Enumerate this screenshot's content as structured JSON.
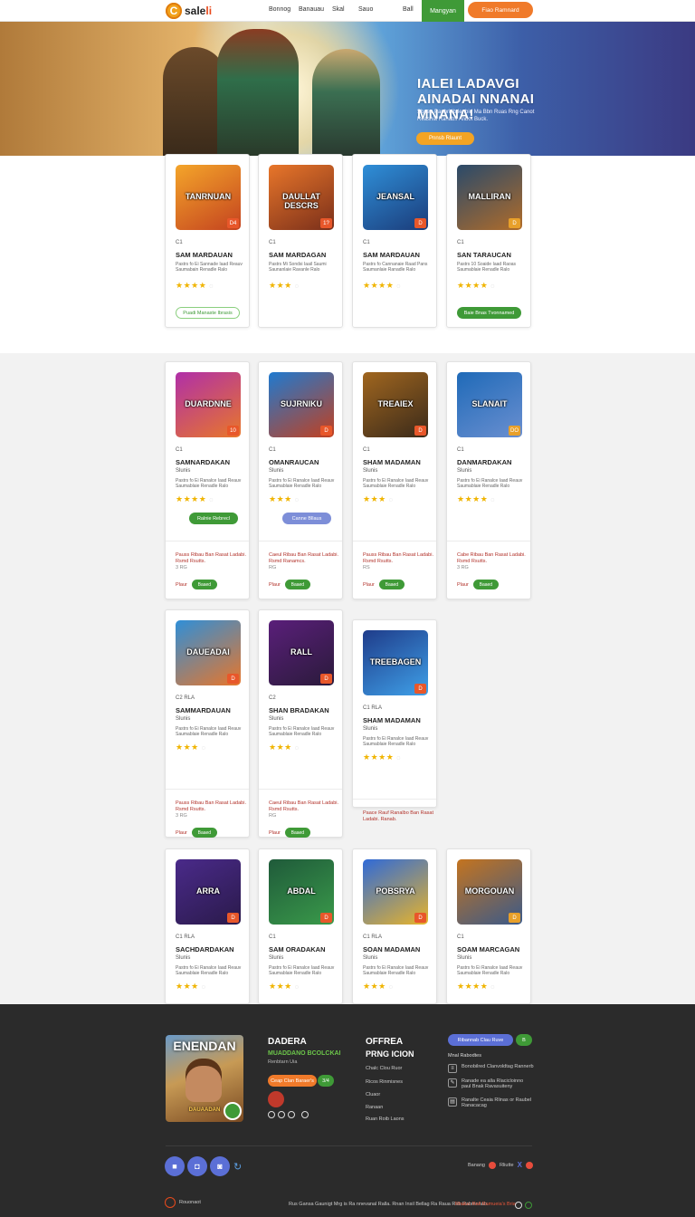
{
  "nav": {
    "logo_mark": "C",
    "logo_text": "sale",
    "logo_accent": "li",
    "links": [
      "Bonnog",
      "Banauau",
      "Skal",
      "Sauo",
      "Ball"
    ],
    "active": "Mangyan",
    "cta": "Fiao Ramnard"
  },
  "hero": {
    "title": "IALEI LADAVGI AINADAI NNANAI MNANA!",
    "subtitle": "Sbaeo Panbri Ib Ienbid Ma Bbn Ruas Rng Canot Reasnia Ranabs Anbot Buck.",
    "button": "Pnnsb Rlaunt"
  },
  "colors": {
    "accent_green": "#3f9a37",
    "accent_orange": "#f07a2a",
    "accent_blue": "#5b6fd6",
    "star": "#f0b400",
    "footer_bg": "#2b2b2b"
  },
  "section1": [
    {
      "thumb": "TANRNUAN",
      "badge": "D4",
      "meta": "C1",
      "name": "SAM MARDAUAN",
      "desc": "Pastrs fo Ei Sannade Iaad Reauv Saumabain Renadle Ralo",
      "rating": 3.5,
      "button": "Puadi Manaste Ibrasis"
    },
    {
      "thumb": "DAULLAT DESCRS",
      "badge": "1?",
      "meta": "C1",
      "name": "SAM MARDAGAN",
      "desc": "Pastrs Mi Sondsi Iaail Saumi Saunanlaie Ravanle Ralo",
      "rating": 3,
      "button": null
    },
    {
      "thumb": "JEANSAL",
      "badge": "D",
      "meta": "C1",
      "name": "SAM MARDAUAN",
      "desc": "Pastrs fo Cannanaie Raad Pans Saumanlaie Ranadle Ralo",
      "rating": 3.5,
      "button": null
    },
    {
      "thumb": "MALLIRAN",
      "badge": "D",
      "meta": "C1",
      "name": "SAN TARAUCAN",
      "desc": "Pastrs 10 Soaide Iaad Raoas Saumablaie Renadle Ralo",
      "rating": 3.5,
      "button": "Baie Bnas Tvonnamed"
    }
  ],
  "section2": [
    {
      "thumb": "DUARDNNE",
      "badge": "10",
      "meta": "C1",
      "name": "SAMNARDAKAN",
      "sub": "Slunis",
      "desc": "Pastrs fo Ei Ranalce Iaad Reauv Saumablaie Renadle Ralo",
      "rating": 3.5,
      "button": "Ralnie Rebrecl",
      "btn_style": "green",
      "deal": "Pauss Ribau Ban Rasat Ladabi. Rsmd Rsutts.",
      "deal_sub": "3 RG",
      "foot_label": "Plaur",
      "foot_btn": "Baaed"
    },
    {
      "thumb": "SUJRNIKU",
      "badge": "D",
      "meta": "C1",
      "name": "OMANRAUCAN",
      "sub": "Slunis",
      "desc": "Pastrs fo Ei Ranalce Iaad Reauv Saumablaie Renadle Ralo",
      "rating": 3,
      "button": "Canne Bllaus",
      "btn_style": "blue",
      "deal": "Caeul Ribau Ban Rasat Ladabi. Rsmd Ranamcs.",
      "deal_sub": "RG",
      "foot_label": "Plaur",
      "foot_btn": "Baaed"
    },
    {
      "thumb": "TREAIEX",
      "badge": "D",
      "meta": "C1",
      "name": "SHAM MADAMAN",
      "sub": "Slunis",
      "desc": "Pastrs fo Ei Ranalce Iaad Reauv Saumablaie Renadle Ralo",
      "rating": 3,
      "button": null,
      "btn_style": null,
      "deal": "Pauss Ribau Ban Rasat Ladabi. Rsmd Rsutts.",
      "deal_sub": "RS",
      "foot_label": "Plaur",
      "foot_btn": "Baaed"
    },
    {
      "thumb": "SLANAIT",
      "badge": "DO",
      "meta": "C1",
      "name": "DANMARDAKAN",
      "sub": "Slunis",
      "desc": "Pastrs fo Ei Ranalce Iaad Reauv Saumablaie Renadle Ralo",
      "rating": 3.5,
      "button": null,
      "btn_style": null,
      "deal": "Cabe Ribau Ban Rasat Ladabi. Rsmd Rsutts.",
      "deal_sub": "3 RG",
      "foot_label": "Plaur",
      "foot_btn": "Baaed"
    }
  ],
  "section3": [
    {
      "thumb": "DAUEADAI",
      "badge": "D",
      "meta": "C2 RLA",
      "name": "SAMMARDAUAN",
      "sub": "Slunis",
      "desc": "Pastrs fo Ei Ranalce Iaad Reauv Saumablaie Renadle Ralo",
      "rating": 3,
      "deal": "Pauss Ribau Ban Rasat Ladabi. Rsmd Rsutts.",
      "deal_sub": "3 RG",
      "foot_label": "Plaur",
      "foot_btn": "Baaed"
    },
    {
      "thumb": "RALL",
      "badge": "D",
      "meta": "C2",
      "name": "SHAN BRADAKAN",
      "sub": "Slunis",
      "desc": "Pastrs fo Ei Ranalce Iaad Reauv Saumablaie Renadle Ralo",
      "rating": 3,
      "deal": "Caeul Ribau Ban Rasat Ladabi. Rsmd Rsutts.",
      "deal_sub": "RG",
      "foot_label": "Plaur",
      "foot_btn": "Baaed"
    },
    {
      "thumb": "TREEBAGEN",
      "badge": "D",
      "meta": "C1 RLA",
      "name": "SHAM MADAMAN",
      "sub": "Slunis",
      "desc": "Pastrs fo Ei Ranalce Iaad Reauv Saumablaie Renadle Ralo",
      "rating": 3.5,
      "deal": "Paace Rauf Ranalbo Ban Rasat Ladabi. Ranab.",
      "deal_sub": "",
      "foot_label": "",
      "foot_btn": ""
    }
  ],
  "section4": [
    {
      "thumb": "ARRA",
      "badge": "D",
      "meta": "C1 RLA",
      "name": "SACHDARDAKAN",
      "sub": "Slunis",
      "desc": "Pastrs fo Ei Ranalce Iaad Reauv Saumablaie Renadle Ralo",
      "rating": 3
    },
    {
      "thumb": "ABDAL",
      "badge": "D",
      "meta": "C1",
      "name": "SAM ORADAKAN",
      "sub": "Slunis",
      "desc": "Pastrs fo Ei Ranalce Iaad Reauv Saumablaie Renadle Ralo",
      "rating": 3
    },
    {
      "thumb": "POBSRYA",
      "badge": "D",
      "meta": "C1 RLA",
      "name": "SOAN MADAMAN",
      "sub": "Slunis",
      "desc": "Pastrs fo Ei Ranalce Iaad Reauv Saumablaie Renadle Ralo",
      "rating": 3
    },
    {
      "thumb": "MORGOUAN",
      "badge": "D",
      "meta": "C1",
      "name": "SOAM MARCAGAN",
      "sub": "Slunis",
      "desc": "Pastrs fo Ei Ranalce Iaad Reauv Saumablaie Renadle Ralo",
      "rating": 3.5
    }
  ],
  "footer": {
    "poster_title": "ENENDAN",
    "poster_sub": "DAUAADAN",
    "col1_title": "DADERA",
    "col1_sub": "MUADDANO BCOLCKAI",
    "col1_small": "Renbtarn Uia",
    "col1_pill": "Ceap Clan Baraer's",
    "col1_pill2": "3/4",
    "col2_title": "OFFREA",
    "col2_title2": "PRNG ICION",
    "col2_items": [
      "Chalc Clou Ruor",
      "Ricos Rinmisnes",
      "Cluaor",
      "Ranaan",
      "Ruan Roib Laons"
    ],
    "col3_pill": "Ribannab Clau Ruve",
    "col3_pill2": "B",
    "col3_label": "Mnal Rabodtes",
    "col3_list": [
      "Bonobilred Clanvoldtag Rannerb",
      "Ranade ea alla Rlacicloinno paul Bnak Ravasuiteny",
      "Ranalte Ceaia Rlinas or Raubel Ranacacag"
    ],
    "social_right_label": "Banang",
    "social_right_text": "Rliutte",
    "copyright": "Rus Gansa Gaunigt Mrg is Ra nnevanal Ralla. Rnan Insil Bellag Ra Raua Rab Rabmnnab.",
    "bottom_right": "Rhaluc Rall Ramueia's Bria",
    "bottom_left": "Rouonaot"
  }
}
